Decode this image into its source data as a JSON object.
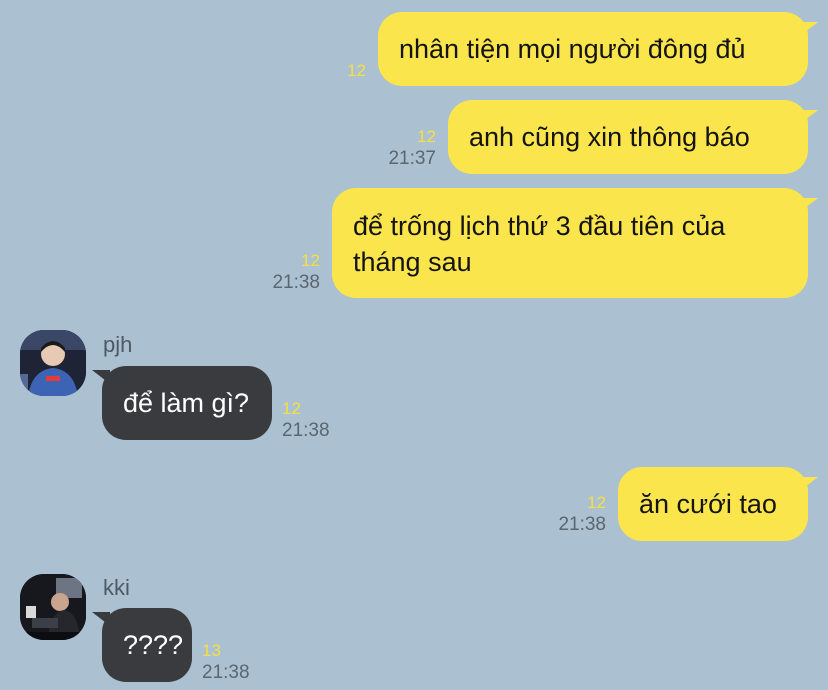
{
  "colors": {
    "background": "#abc1d1",
    "outgoing_bubble": "#fbe54c",
    "incoming_bubble": "#3a3b3e",
    "unread_count": "#f6df42"
  },
  "messages": [
    {
      "direction": "out",
      "text": "nhân tiện mọi người đông đủ",
      "unread": "12",
      "time": ""
    },
    {
      "direction": "out",
      "text": "anh cũng xin thông báo",
      "unread": "12",
      "time": "21:37"
    },
    {
      "direction": "out",
      "text": "để trống lịch thứ 3 đầu tiên của tháng sau",
      "unread": "12",
      "time": "21:38"
    },
    {
      "direction": "in",
      "sender": "pjh",
      "avatar_icon": "user-avatar-icon",
      "text": "để làm gì?",
      "unread": "12",
      "time": "21:38"
    },
    {
      "direction": "out",
      "text": "ăn cưới tao",
      "unread": "12",
      "time": "21:38"
    },
    {
      "direction": "in",
      "sender": "kki",
      "avatar_icon": "user-avatar-icon",
      "text": "????",
      "unread": "13",
      "time": "21:38"
    }
  ]
}
